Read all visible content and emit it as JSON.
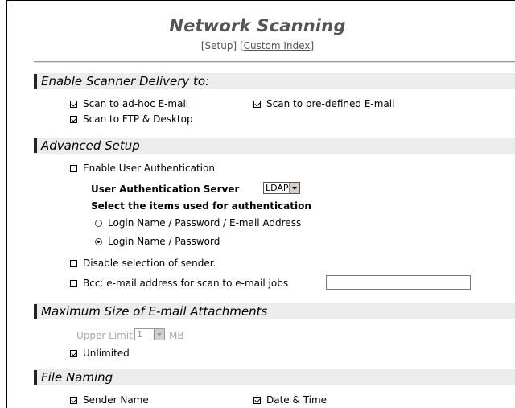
{
  "header": {
    "title": "Network Scanning",
    "link_open": "[",
    "setup_label": "Setup",
    "link_mid": "] [",
    "custom_index_label": "Custom Index",
    "link_close": "]"
  },
  "delivery": {
    "heading": "Enable Scanner Delivery to:",
    "adhoc_email": {
      "label": "Scan to ad-hoc E-mail",
      "checked": true
    },
    "predefined_email": {
      "label": "Scan to pre-defined E-mail",
      "checked": true
    },
    "ftp_desktop": {
      "label": "Scan to FTP & Desktop",
      "checked": true
    }
  },
  "advanced": {
    "heading": "Advanced Setup",
    "user_auth": {
      "label": "Enable User Authentication",
      "checked": false
    },
    "auth_server_label": "User Authentication Server",
    "auth_server_value": "LDAP",
    "select_items_label": "Select the items used for authentication",
    "option_full": {
      "label": "Login Name / Password / E-mail Address",
      "selected": false
    },
    "option_basic": {
      "label": "Login Name / Password",
      "selected": true
    },
    "disable_sender": {
      "label": "Disable selection of sender.",
      "checked": false
    },
    "bcc": {
      "label": "Bcc: e-mail address for scan to e-mail jobs",
      "checked": false,
      "value": ""
    }
  },
  "attachments": {
    "heading": "Maximum Size of E-mail Attachments",
    "upper_limit_label": "Upper Limit",
    "upper_limit_value": "1",
    "unit": "MB",
    "unlimited": {
      "label": "Unlimited",
      "checked": true
    }
  },
  "file_naming": {
    "heading": "File Naming",
    "sender_name": {
      "label": "Sender Name",
      "checked": true
    },
    "date_time": {
      "label": "Date & Time",
      "checked": true
    }
  }
}
